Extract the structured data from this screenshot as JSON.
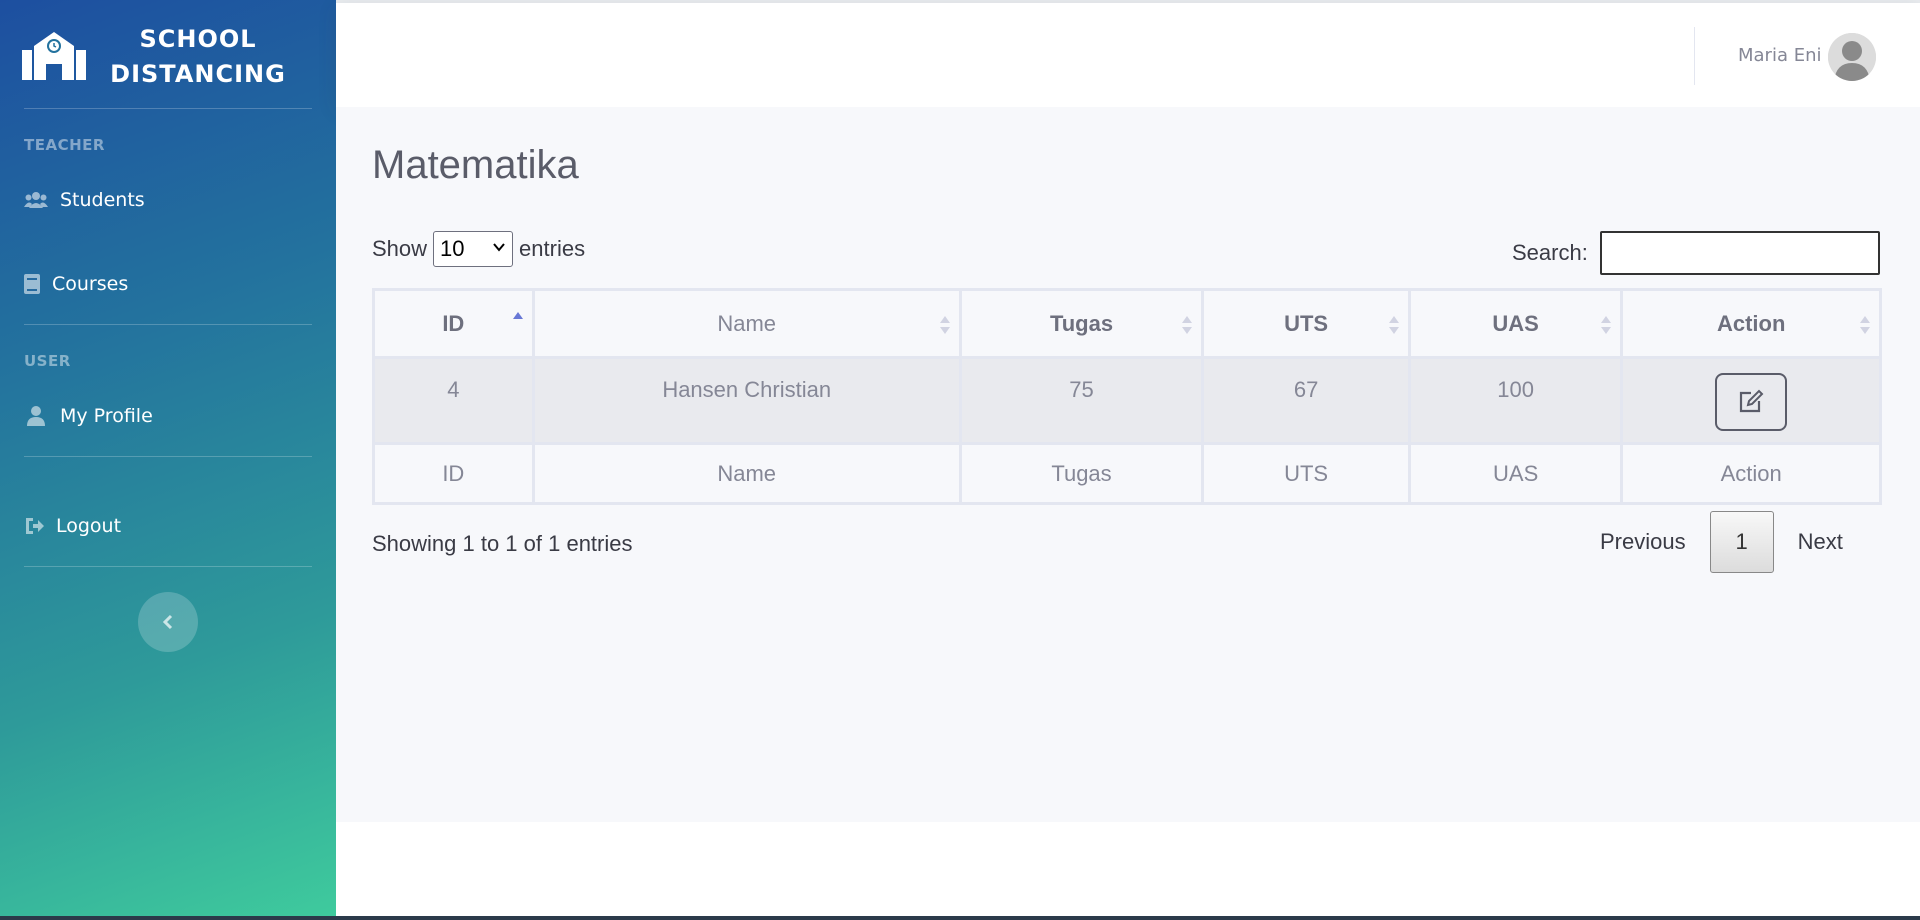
{
  "sidebar": {
    "brand_line1": "SCHOOL",
    "brand_line2": "DISTANCING",
    "sections": [
      {
        "heading": "TEACHER"
      },
      {
        "heading": "USER"
      }
    ],
    "items": [
      {
        "label": "Students",
        "icon": "users-icon"
      },
      {
        "label": "Courses",
        "icon": "book-icon"
      },
      {
        "label": "My Profile",
        "icon": "user-icon"
      },
      {
        "label": "Logout",
        "icon": "sign-out-icon"
      }
    ],
    "toggle_icon": "chevron-left-icon"
  },
  "topbar": {
    "user_name": "Maria Eni",
    "avatar_icon": "avatar-icon"
  },
  "main": {
    "title": "Matematika",
    "length_prefix": "Show",
    "length_value": "10",
    "length_suffix": "entries",
    "search_label": "Search:",
    "search_value": "",
    "columns": [
      "ID",
      "Name",
      "Tugas",
      "UTS",
      "UAS",
      "Action"
    ],
    "rows": [
      {
        "id": "4",
        "name": "Hansen Christian",
        "tugas": "75",
        "uts": "67",
        "uas": "100",
        "action_icon": "edit-icon"
      }
    ],
    "info": "Showing 1 to 1 of 1 entries",
    "pagination": {
      "previous": "Previous",
      "current": "1",
      "next": "Next"
    }
  },
  "colors": {
    "sidebar_top": "#1d4fa0",
    "sidebar_bottom": "#3fcb9d",
    "sort_active": "#4e73df"
  }
}
